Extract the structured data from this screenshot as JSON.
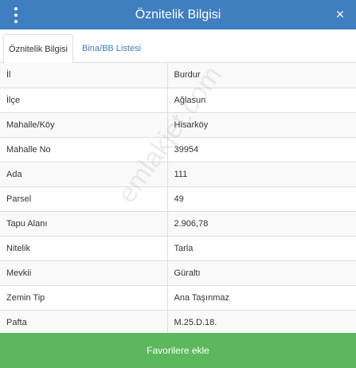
{
  "header": {
    "title": "Öznitelik Bilgisi",
    "close_glyph": "×",
    "menu_icon": "vertical-ellipsis-icon",
    "color": "#3f7ebf"
  },
  "tabs": [
    {
      "label": "Öznitelik Bilgisi",
      "active": true
    },
    {
      "label": "Bina/BB Listesi",
      "active": false
    }
  ],
  "attributes": [
    {
      "key": "İl",
      "value": "Burdur"
    },
    {
      "key": "İlçe",
      "value": "Ağlasun"
    },
    {
      "key": "Mahalle/Köy",
      "value": "Hisarköy"
    },
    {
      "key": "Mahalle No",
      "value": "39954"
    },
    {
      "key": "Ada",
      "value": "111"
    },
    {
      "key": "Parsel",
      "value": "49"
    },
    {
      "key": "Tapu Alanı",
      "value": "2.906,78"
    },
    {
      "key": "Nitelik",
      "value": "Tarla"
    },
    {
      "key": "Mevkii",
      "value": "Güraltı"
    },
    {
      "key": "Zemin Tip",
      "value": "Ana Taşınmaz"
    },
    {
      "key": "Pafta",
      "value": "M.25.D.18."
    }
  ],
  "watermark": "emlakjet.com",
  "footer": {
    "favorite_label": "Favorilere ekle",
    "color": "#5cb85c"
  }
}
